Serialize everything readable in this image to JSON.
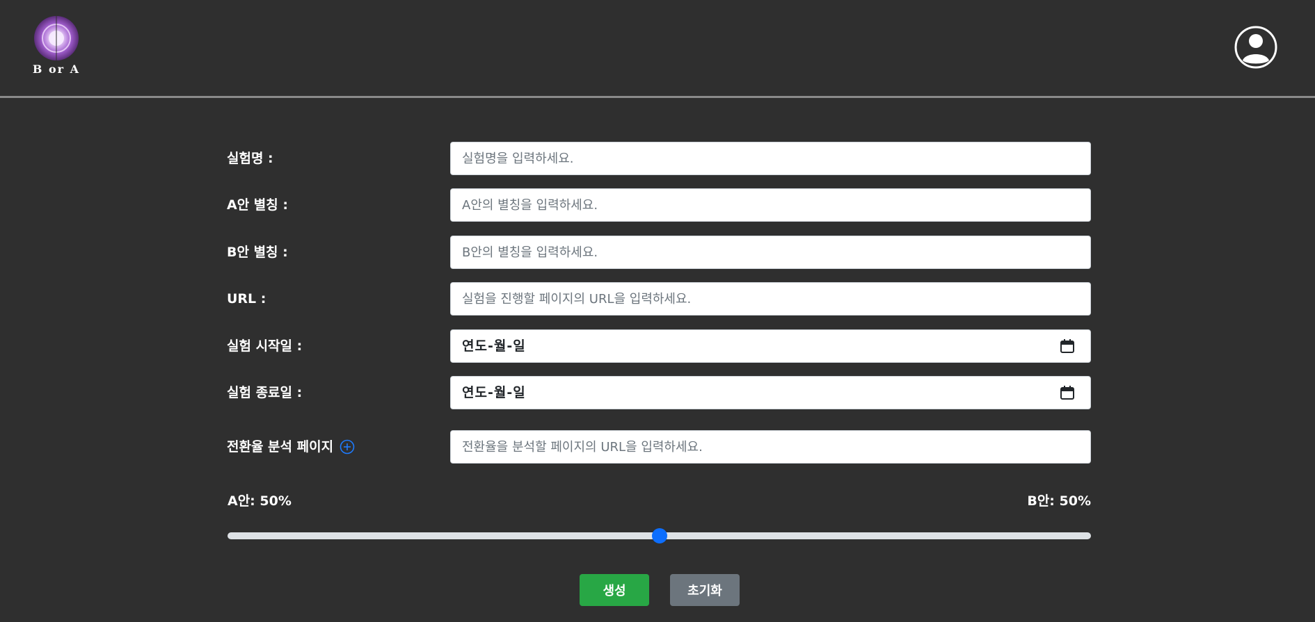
{
  "header": {
    "logo_text": "B or A",
    "profile_icon": "user-circle-icon"
  },
  "form": {
    "experiment_name": {
      "label": "실험명 :",
      "placeholder": "실험명을 입력하세요.",
      "value": ""
    },
    "a_alias": {
      "label": "A안 별칭 :",
      "placeholder": "A안의 별칭을 입력하세요.",
      "value": ""
    },
    "b_alias": {
      "label": "B안 별칭 :",
      "placeholder": "B안의 별칭을 입력하세요.",
      "value": ""
    },
    "url": {
      "label": "URL :",
      "placeholder": "실험을 진행할 페이지의 URL을 입력하세요.",
      "value": ""
    },
    "start_date": {
      "label": "실험 시작일 :",
      "display": "연도-월-일",
      "icon": "calendar-icon"
    },
    "end_date": {
      "label": "실험 종료일 :",
      "display": "연도-월-일",
      "icon": "calendar-icon"
    },
    "conversion_page": {
      "label": "전환율 분석 페이지",
      "placeholder": "전환율을 분석할 페이지의 URL을 입력하세요.",
      "value": "",
      "add_icon": "plus-circle-icon"
    }
  },
  "ratio": {
    "a_label": "A안: 50%",
    "b_label": "B안: 50%",
    "a_percent": 50
  },
  "buttons": {
    "create": "생성",
    "reset": "초기화"
  },
  "colors": {
    "background": "#2f2f2f",
    "accent_blue": "#0d6efd",
    "create_green": "#28a745",
    "reset_gray": "#6c757d"
  }
}
